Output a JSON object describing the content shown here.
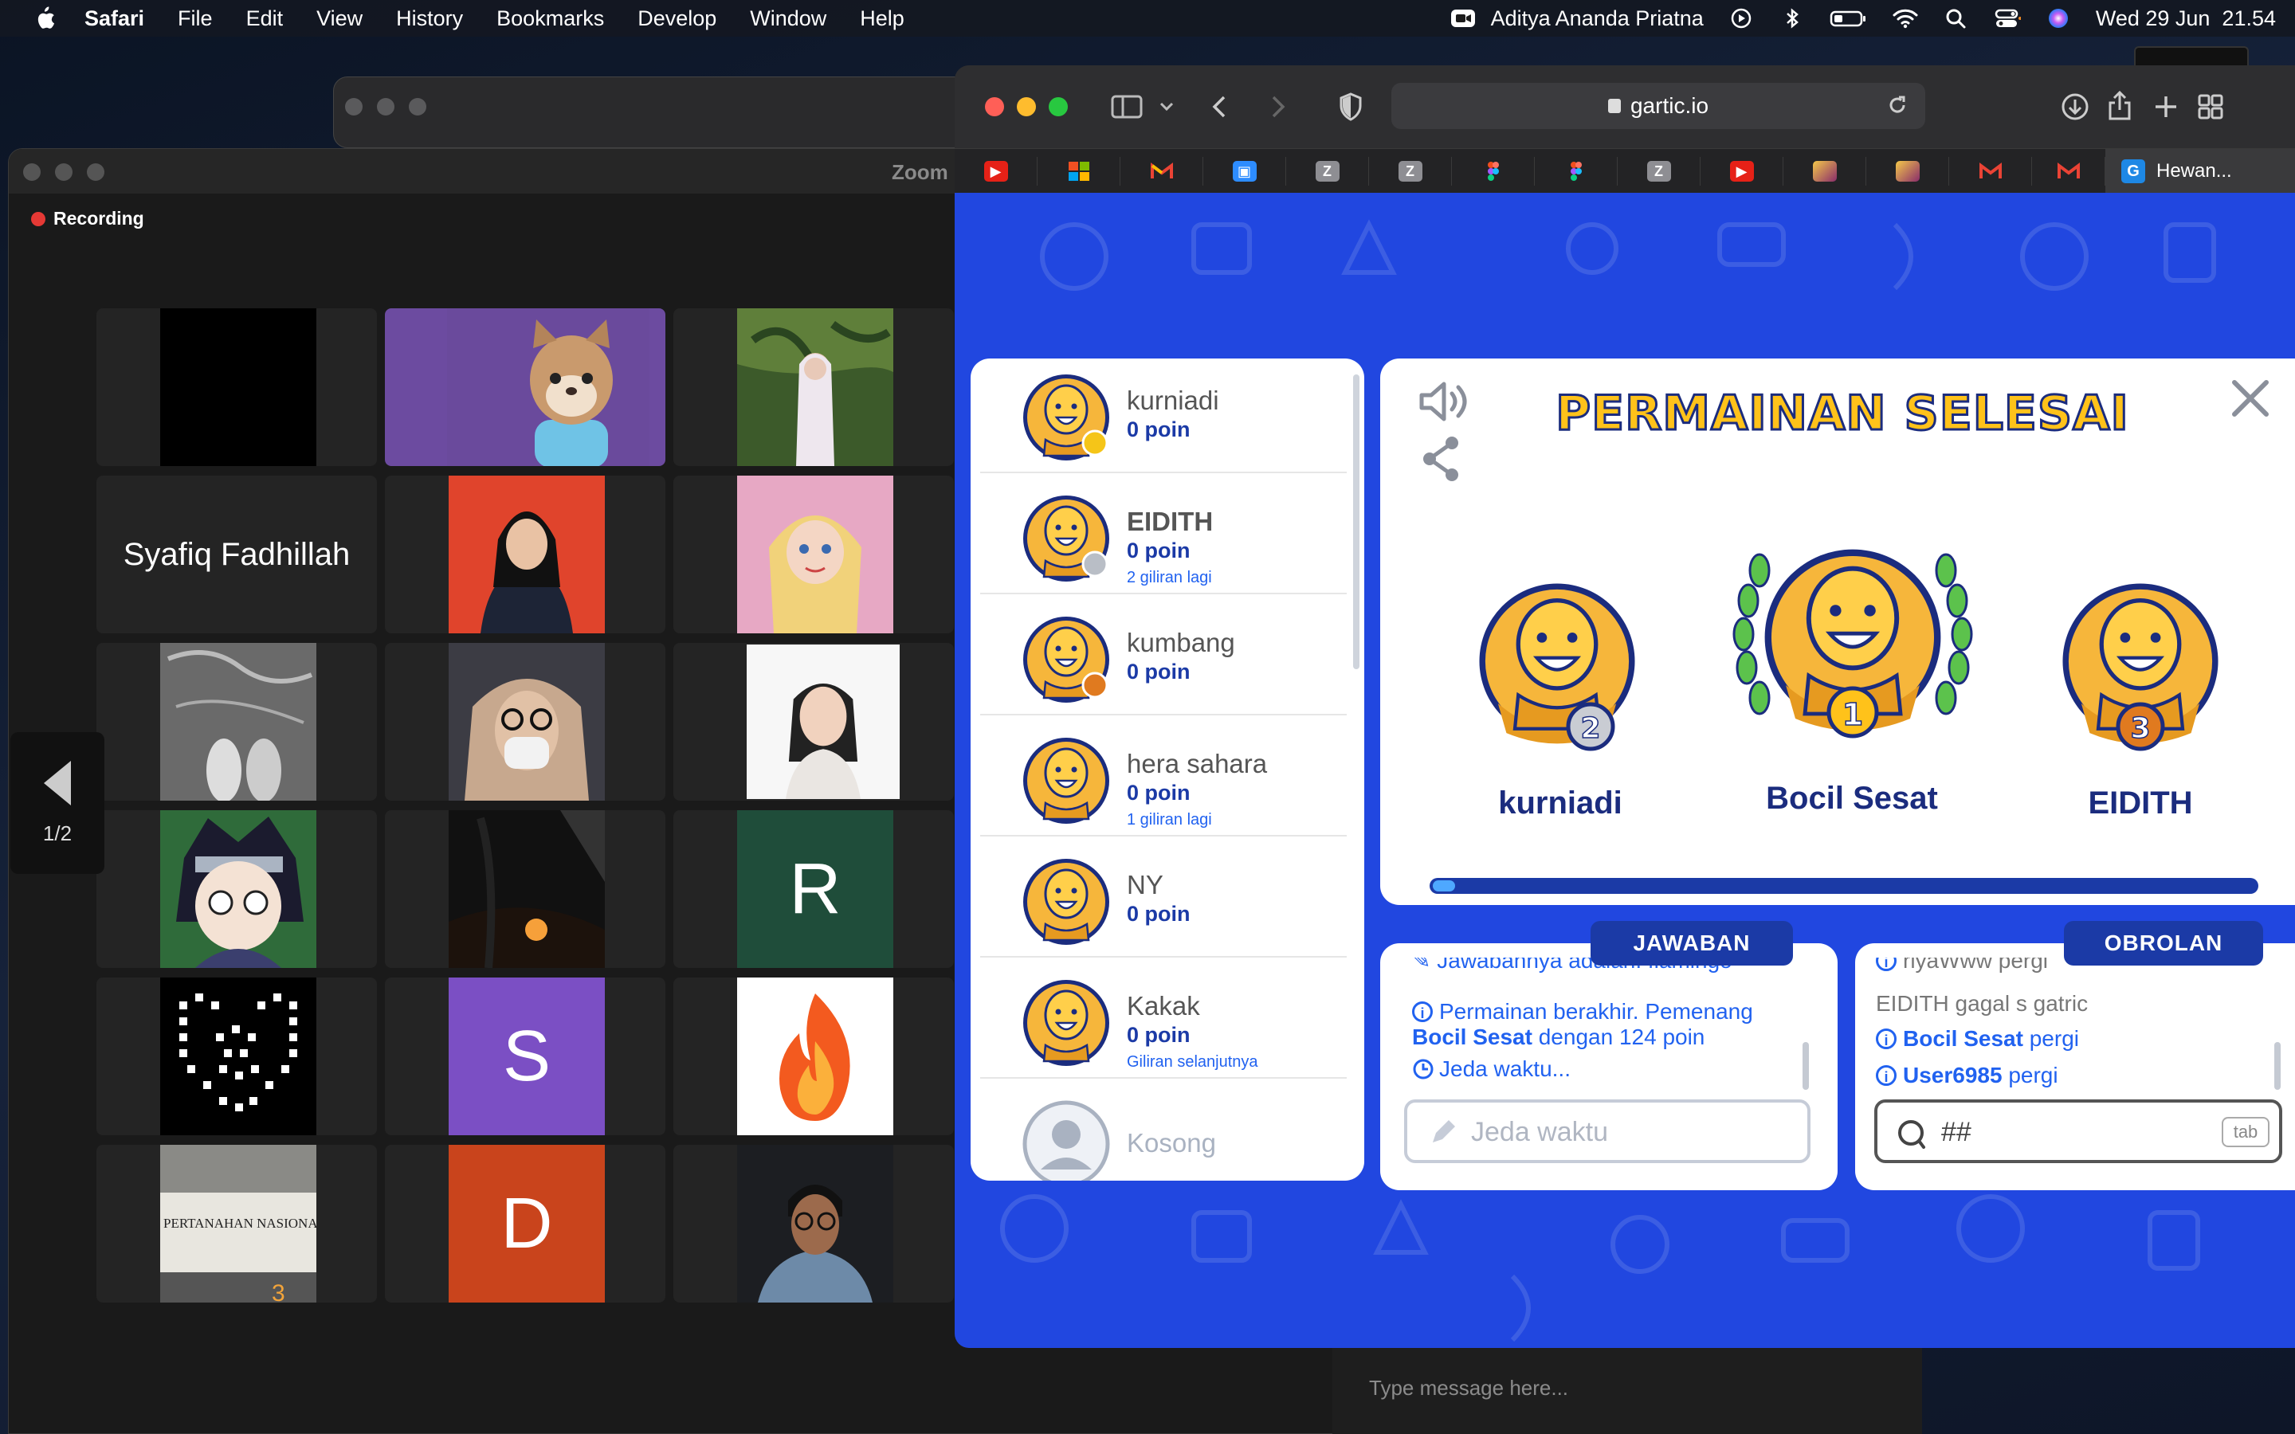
{
  "menubar": {
    "app_name": "Safari",
    "items": [
      "File",
      "Edit",
      "View",
      "History",
      "Bookmarks",
      "Develop",
      "Window",
      "Help"
    ],
    "user_name": "Aditya Ananda Priatna",
    "datetime": "Wed 29 Jun  21.54"
  },
  "zoom": {
    "title": "Zoom",
    "recording_label": "Recording",
    "pager_label": "1/2",
    "tiles": [
      {
        "label": ""
      },
      {
        "label": ""
      },
      {
        "label": ""
      },
      {
        "label": "Syafiq Fadhillah"
      },
      {
        "label": ""
      },
      {
        "label": ""
      },
      {
        "label": ""
      },
      {
        "label": ""
      },
      {
        "label": ""
      },
      {
        "label": ""
      },
      {
        "label": ""
      },
      {
        "letter": "R"
      },
      {
        "label": ""
      },
      {
        "letter": "S"
      },
      {
        "label": ""
      },
      {
        "label": ""
      },
      {
        "letter": "D"
      },
      {
        "label": ""
      }
    ],
    "chat_placeholder": "Type message here..."
  },
  "safari": {
    "url": "gartic.io",
    "active_tab_title": "Hewan...",
    "favorites": [
      "youtube-icon",
      "microsoft-icon",
      "gmail-icon",
      "zoom-icon",
      "z-icon",
      "z-icon",
      "figma-icon",
      "figma-icon",
      "z-icon",
      "youtube-icon",
      "app-icon",
      "app-icon",
      "gmail-icon",
      "gmail-icon"
    ]
  },
  "gartic": {
    "result_title": "PERMAINAN SELESAI",
    "podium": {
      "first": {
        "name": "Bocil Sesat",
        "rank": "1"
      },
      "second": {
        "name": "kurniadi",
        "rank": "2"
      },
      "third": {
        "name": "EIDITH",
        "rank": "3"
      }
    },
    "progress_fraction": 0.015,
    "players": [
      {
        "name": "kurniadi",
        "points": "0 poin",
        "note": "",
        "badge": "#f5c518"
      },
      {
        "name": "EIDITH",
        "points": "0 poin",
        "note": "2 giliran lagi",
        "badge": "#b9bec6"
      },
      {
        "name": "kumbang",
        "points": "0 poin",
        "note": "",
        "badge": "#e07a1f"
      },
      {
        "name": "hera sahara",
        "points": "0 poin",
        "note": "1 giliran lagi",
        "badge": ""
      },
      {
        "name": "NY",
        "points": "0 poin",
        "note": "",
        "badge": ""
      },
      {
        "name": "Kakak",
        "points": "0 poin",
        "note": "Giliran selanjutnya",
        "badge": ""
      }
    ],
    "empty_slot_label": "Kosong",
    "answer_tab": "JAWABAN",
    "chat_tab": "OBROLAN",
    "answer_messages": {
      "m0": "Jawabannya adalah: flamingo",
      "m1_a": "Permainan berakhir. Pemenang",
      "m1_b": "Bocil Sesat",
      "m1_c": " dengan 124 poin",
      "m2": "Jeda waktu..."
    },
    "answer_placeholder": "Jeda waktu",
    "chat_messages": {
      "c0": "riyaWww pergi",
      "c1_a": "EIDITH",
      "c1_b": " gagal s gatric",
      "c2_a": "Bocil Sesat",
      "c2_b": " pergi",
      "c3_a": "User6985",
      "c3_b": " pergi"
    },
    "chat_placeholder": "##",
    "tab_key_label": "tab"
  },
  "colors": {
    "gartic_blue": "#2147e0",
    "gartic_navy": "#1b3aa6",
    "gold": "#ffc21a",
    "zoom_tile_bg": "#242424"
  }
}
